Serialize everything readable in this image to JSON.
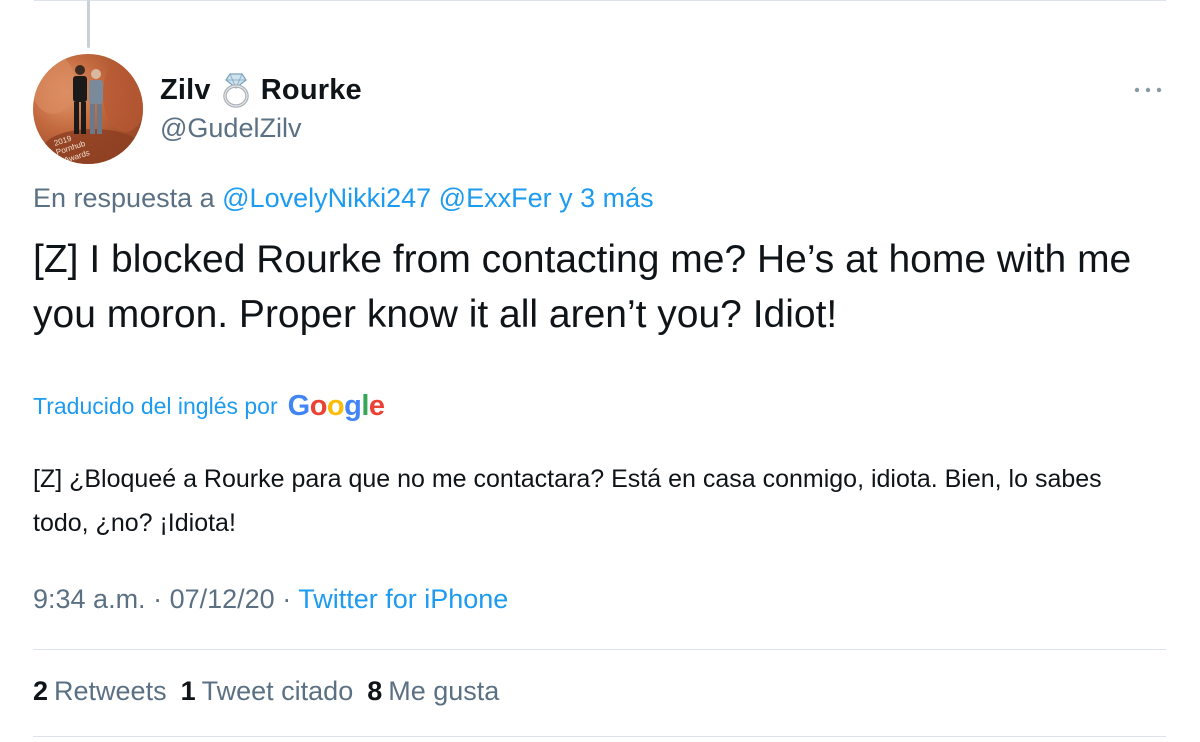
{
  "author": {
    "name_first": "Zilv",
    "name_icon": "ring-emoji",
    "name_last": "Rourke",
    "handle": "@GudelZilv",
    "avatar_text": "2019 Pornhub Awards"
  },
  "header": {
    "more_icon": "more-horizontal-icon"
  },
  "reply": {
    "prefix": "En respuesta a",
    "mention1": "@LovelyNikki247",
    "mention2": "@ExxFer",
    "suffix": "y 3 más"
  },
  "tweet": {
    "text": "[Z] I blocked Rourke from contacting me? He’s at home with me you moron. Proper know it all aren’t you? Idiot!"
  },
  "translation": {
    "label": "Traducido del inglés por",
    "provider": "Google",
    "text": "[Z] ¿Bloqueé a Rourke para que no me contactara? Está en casa conmigo, idiota. Bien, lo sabes todo, ¿no? ¡Idiota!"
  },
  "meta": {
    "time": "9:34 a.m.",
    "separator": "·",
    "date": "07/12/20",
    "source": "Twitter for iPhone"
  },
  "stats": {
    "retweets_count": "2",
    "retweets_label": "Retweets",
    "quotes_count": "1",
    "quotes_label": "Tweet citado",
    "likes_count": "8",
    "likes_label": "Me gusta"
  },
  "colors": {
    "accent": "#1d9bf0",
    "secondary_text": "#5b7083",
    "primary_text": "#0f1419",
    "divider": "#dde3e8",
    "google_blue": "#4285f4",
    "google_red": "#ea4335",
    "google_yellow": "#fbbc05",
    "google_green": "#34a853"
  }
}
